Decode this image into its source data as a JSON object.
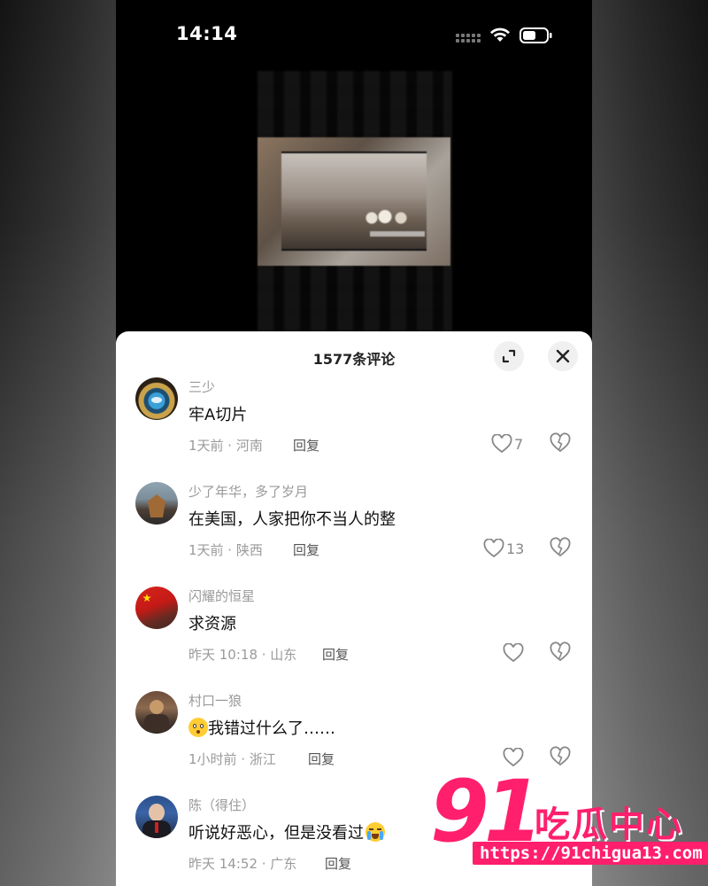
{
  "status_bar": {
    "time": "14:14"
  },
  "sheet": {
    "comment_count_label": "1577条评论"
  },
  "comments": [
    {
      "username": "三少",
      "text": "牢A切片",
      "meta": "1天前 · 河南",
      "reply": "回复",
      "likes": "7"
    },
    {
      "username": "少了年华，多了岁月",
      "text": "在美国，人家把你不当人的整",
      "meta": "1天前 · 陕西",
      "reply": "回复",
      "likes": "13"
    },
    {
      "username": "闪耀的恒星",
      "text": "求资源",
      "meta": "昨天 10:18 · 山东",
      "reply": "回复",
      "likes": ""
    },
    {
      "username": "村口一狼",
      "text": "我错过什么了……",
      "meta": "1小时前 · 浙江",
      "reply": "回复",
      "likes": ""
    },
    {
      "username": "陈（得住）",
      "text": "听说好恶心，但是没看过",
      "meta": "昨天 14:52 · 广东",
      "reply": "回复",
      "likes": ""
    }
  ],
  "watermark": {
    "brand_number": "91",
    "brand_text": "吃瓜中心",
    "url": "https://91chigua13.com"
  },
  "colors": {
    "accent": "#ff1f6d",
    "meta_text": "#9a9a9a",
    "sheet_bg": "#ffffff"
  },
  "icons": [
    "search-icon",
    "expand-icon",
    "close-icon",
    "heart-icon",
    "broken-heart-icon",
    "wifi-icon",
    "battery-icon",
    "signal-icon"
  ]
}
